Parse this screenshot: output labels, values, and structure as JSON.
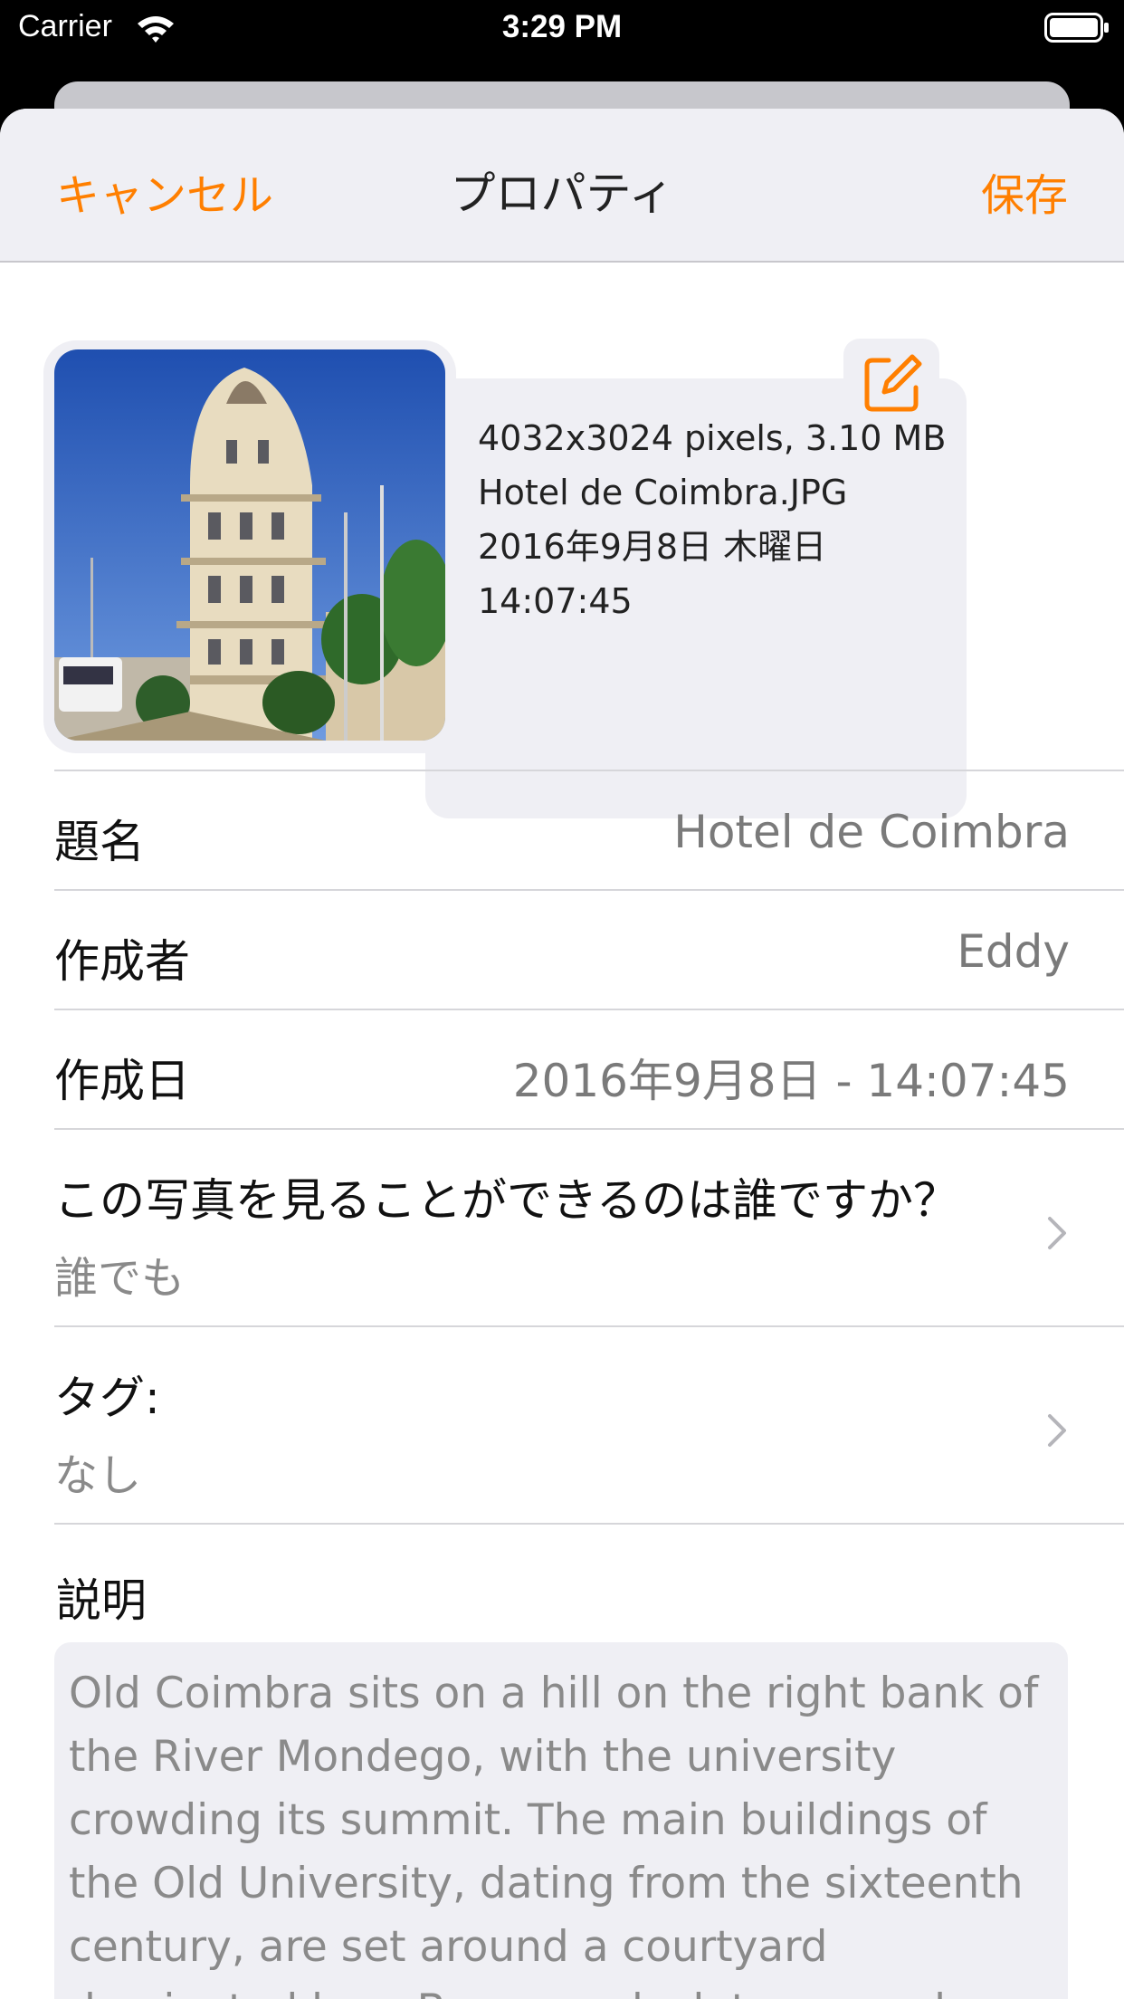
{
  "status_bar": {
    "carrier": "Carrier",
    "time": "3:29 PM",
    "icons": [
      "wifi-icon",
      "battery-icon"
    ]
  },
  "nav": {
    "cancel_label": "キャンセル",
    "title": "プロパティ",
    "save_label": "保存"
  },
  "photo_info": {
    "dimensions_size": "4032x3024 pixels, 3.10 MB",
    "filename": "Hotel de Coimbra.JPG",
    "date": "2016年9月8日 木曜日",
    "time": "14:07:45",
    "edit_icon": "edit-icon"
  },
  "fields": {
    "title": {
      "label": "題名",
      "value": "Hotel de Coimbra"
    },
    "author": {
      "label": "作成者",
      "value": "Eddy"
    },
    "created": {
      "label": "作成日",
      "value": "2016年9月8日 - 14:07:45"
    },
    "privacy": {
      "label": "この写真を見ることができるのは誰ですか？",
      "value": "誰でも"
    },
    "tags": {
      "label": "タグ:",
      "value": "なし"
    }
  },
  "description": {
    "label": "説明",
    "text": "Old Coimbra sits on a hill on the right bank of the River Mondego, with the university crowding its summit. The main buildings of the Old University, dating from the sixteenth century, are set around a courtyard dominated by a Baroque clock tower and"
  },
  "colors": {
    "accent": "#ff7f00",
    "nav_background": "#efeff4",
    "secondary_text": "#7a7a7a"
  }
}
